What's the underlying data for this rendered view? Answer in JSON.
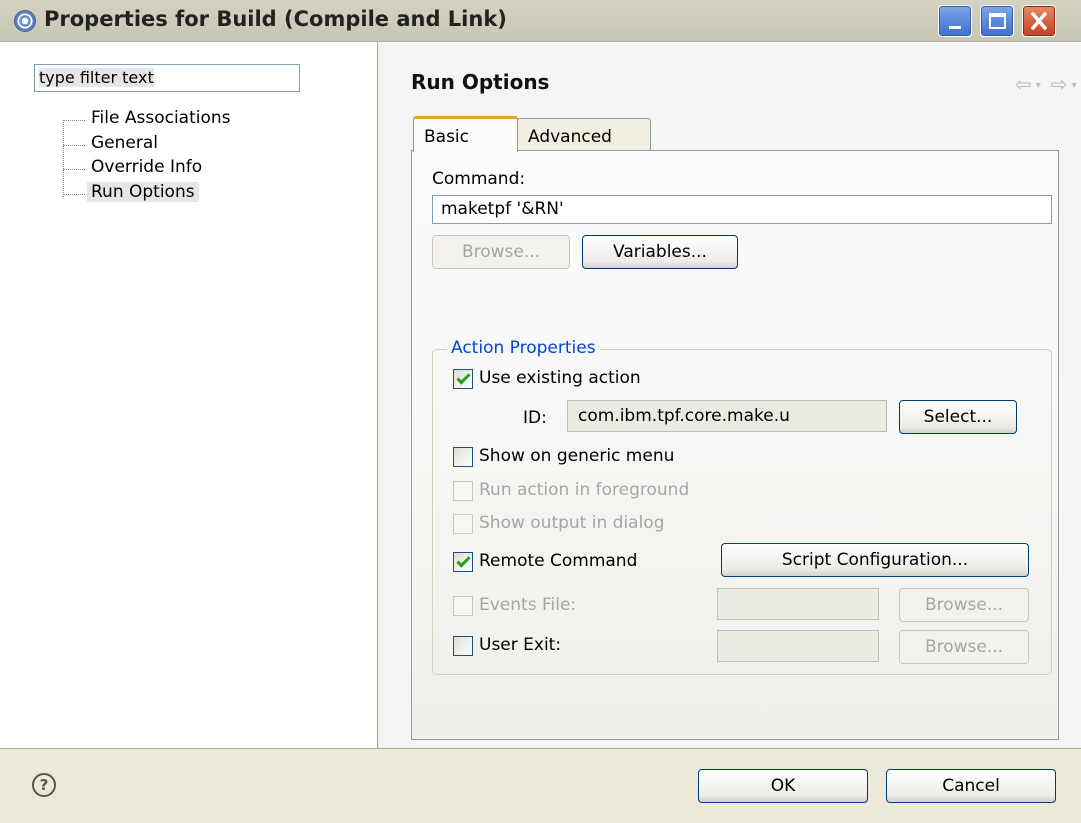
{
  "window": {
    "title": "Properties for Build (Compile and Link)"
  },
  "left": {
    "filter_text": "type filter text",
    "tree": [
      {
        "label": "File Associations"
      },
      {
        "label": "General"
      },
      {
        "label": "Override Info"
      },
      {
        "label": "Run Options",
        "selected": true
      }
    ]
  },
  "page": {
    "title": "Run Options",
    "nav": {
      "back": "⇦",
      "forward": "⇨",
      "dropdown": "▾"
    },
    "tabs": [
      {
        "label": "Basic",
        "active": true
      },
      {
        "label": "Advanced",
        "active": false
      }
    ],
    "command": {
      "label": "Command:",
      "value": "maketpf '&RN'",
      "browse_label": "Browse...",
      "variables_label": "Variables..."
    },
    "action_properties": {
      "title": "Action Properties",
      "use_existing_action": {
        "label": "Use existing action",
        "checked": true
      },
      "id_label": "ID:",
      "id_value": "com.ibm.tpf.core.make.u",
      "select_label": "Select...",
      "show_on_generic_menu": {
        "label": "Show on generic menu",
        "checked": false
      },
      "run_action_in_foreground": {
        "label": "Run action in foreground",
        "checked": false,
        "disabled": true
      },
      "show_output_in_dialog": {
        "label": "Show output in dialog",
        "checked": false,
        "disabled": true
      },
      "remote_command": {
        "label": "Remote Command",
        "checked": true
      },
      "script_configuration_label": "Script Configuration...",
      "events_file": {
        "label": "Events File:",
        "checked": false,
        "disabled": true,
        "browse_label": "Browse..."
      },
      "user_exit": {
        "label": "User Exit:",
        "checked": false,
        "browse_label": "Browse..."
      }
    }
  },
  "footer": {
    "help_icon": "?",
    "ok_label": "OK",
    "cancel_label": "Cancel"
  },
  "colors": {
    "group_title": "#0046d5",
    "check_green": "#21a121",
    "tab_highlight": "#f0a030"
  }
}
